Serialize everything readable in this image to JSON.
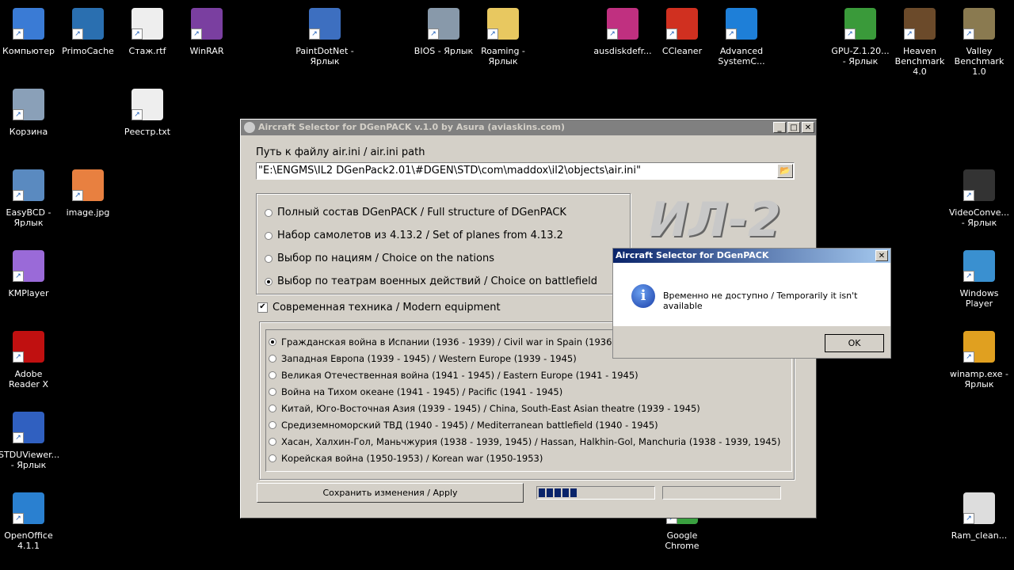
{
  "desktop": {
    "icons": [
      {
        "label": "Компьютер",
        "color": "#3a7bd5"
      },
      {
        "label": "PrimoCache",
        "color": "#2a6fb0"
      },
      {
        "label": "Стаж.rtf",
        "color": "#eeeeee"
      },
      {
        "label": "WinRAR",
        "color": "#7a3fa0"
      },
      {
        "label": "PaintDotNet - Ярлык",
        "color": "#3d6fc0"
      },
      {
        "label": "BIOS - Ярлык",
        "color": "#8899aa"
      },
      {
        "label": "Roaming - Ярлык",
        "color": "#e8c860"
      },
      {
        "label": "ausdiskdefr...",
        "color": "#c03080"
      },
      {
        "label": "CCleaner",
        "color": "#d03020"
      },
      {
        "label": "Advanced SystemC...",
        "color": "#1e7fd8"
      },
      {
        "label": "GPU-Z.1.20... - Ярлык",
        "color": "#3a9a3a"
      },
      {
        "label": "Heaven Benchmark 4.0",
        "color": "#6b4a2a"
      },
      {
        "label": "Valley Benchmark 1.0",
        "color": "#8a7a50"
      },
      {
        "label": "Корзина",
        "color": "#8aa0b8"
      },
      {
        "label": "Реестр.txt",
        "color": "#eeeeee"
      },
      {
        "label": "EasyBCD - Ярлык",
        "color": "#5a8ac0"
      },
      {
        "label": "image.jpg",
        "color": "#e88040"
      },
      {
        "label": "VideoConve... - Ярлык",
        "color": "#333333"
      },
      {
        "label": "KMPlayer",
        "color": "#9a6ad8"
      },
      {
        "label": "Windows Player",
        "color": "#3a90d0"
      },
      {
        "label": "Adobe Reader X",
        "color": "#c01010"
      },
      {
        "label": "winamp.exe - Ярлык",
        "color": "#e0a020"
      },
      {
        "label": "STDUViewer... - Ярлык",
        "color": "#3060c0"
      },
      {
        "label": "OpenOffice 4.1.1",
        "color": "#2a80d0"
      },
      {
        "label": "Google Chrome",
        "color": "#3aa040"
      },
      {
        "label": "Ram_clean...",
        "color": "#dddddd"
      }
    ]
  },
  "window": {
    "title": "Aircraft Selector for DGenPACK v.1.0 by Asura (aviaskins.com)",
    "path_label": "Путь к файлу air.ini / air.ini path",
    "path_value": "\"E:\\ENGMS\\IL2 DGenPack2.01\\#DGEN\\STD\\com\\maddox\\il2\\objects\\air.ini\"",
    "logo_text": "ИЛ-2",
    "modes": [
      {
        "label": "Полный состав DGenPACK / Full structure of DGenPACK",
        "checked": false
      },
      {
        "label": "Набор самолетов из 4.13.2 / Set of planes from 4.13.2",
        "checked": false
      },
      {
        "label": "Выбор по нациям / Choice on the nations",
        "checked": false
      },
      {
        "label": "Выбор по театрам военных действий / Choice on battlefield",
        "checked": true
      }
    ],
    "modern_label": "Современная техника / Modern equipment",
    "modern_checked": true,
    "theatres": [
      {
        "label": "Гражданская война в Испании (1936 - 1939) / Civil war in Spain (1936 - 1939)",
        "checked": true
      },
      {
        "label": "Западная Европа (1939 - 1945) / Western Europe (1939 - 1945)",
        "checked": false
      },
      {
        "label": "Великая Отечественная война (1941 - 1945) / Eastern Europe (1941 - 1945)",
        "checked": false
      },
      {
        "label": "Война на Тихом океане (1941 - 1945) / Pacific (1941 - 1945)",
        "checked": false
      },
      {
        "label": "Китай, Юго-Восточная Азия (1939 - 1945) / China, South-East Asian theatre (1939 - 1945)",
        "checked": false
      },
      {
        "label": "Средиземноморский ТВД (1940 - 1945) / Mediterranean battlefield (1940 - 1945)",
        "checked": false
      },
      {
        "label": "Хасан, Халхин-Гол, Маньчжурия (1938 - 1939, 1945) / Hassan, Halkhin-Gol, Manchuria (1938 - 1939, 1945)",
        "checked": false
      },
      {
        "label": "Корейская война (1950-1953) / Korean war (1950-1953)",
        "checked": false
      }
    ],
    "apply_label": "Сохранить изменения / Apply",
    "progress_percent": 33
  },
  "dialog": {
    "title": "Aircraft Selector for DGenPACK",
    "message": "Временно не доступно / Temporarily it isn't available",
    "ok_label": "OK"
  }
}
